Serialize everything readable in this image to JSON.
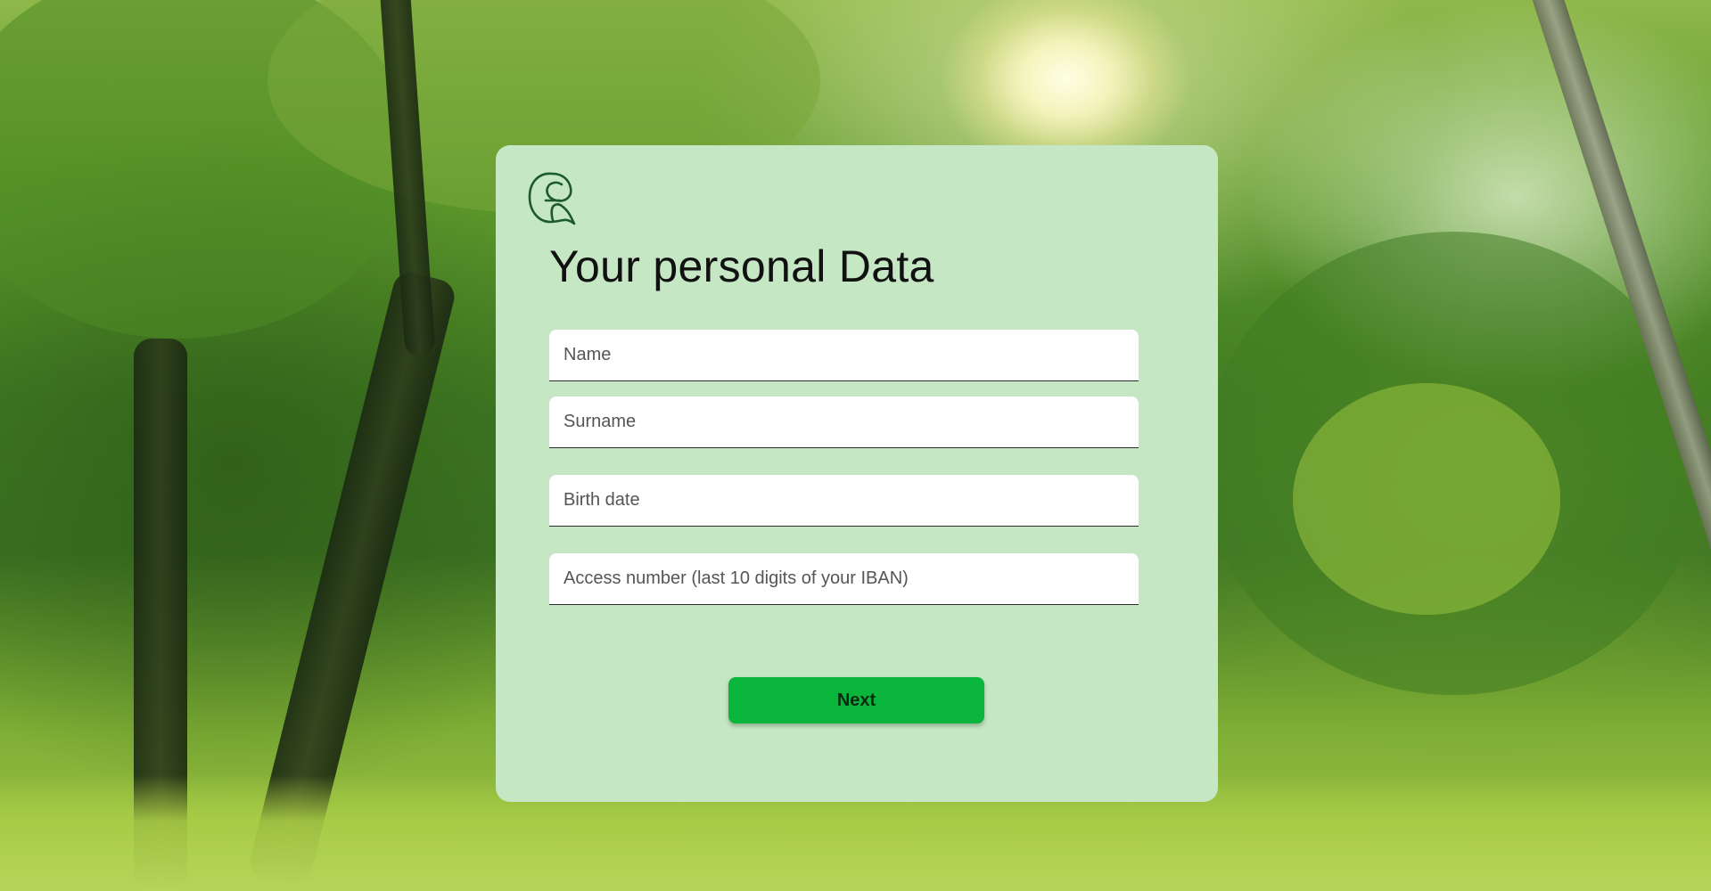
{
  "page": {
    "title": "Your personal Data"
  },
  "brand": {
    "logo_icon": "leaf-g-logo-icon",
    "logo_color": "#1c5a2a"
  },
  "form": {
    "fields": [
      {
        "name": "name",
        "placeholder": "Name",
        "value": ""
      },
      {
        "name": "surname",
        "placeholder": "Surname",
        "value": ""
      },
      {
        "name": "birth_date",
        "placeholder": "Birth date",
        "value": ""
      },
      {
        "name": "access_number",
        "placeholder": "Access number (last 10 digits of your IBAN)",
        "value": ""
      }
    ],
    "next_label": "Next"
  },
  "colors": {
    "card_background": "#c5e7c3",
    "button_background": "#0ab53b",
    "field_background": "#ffffff"
  }
}
